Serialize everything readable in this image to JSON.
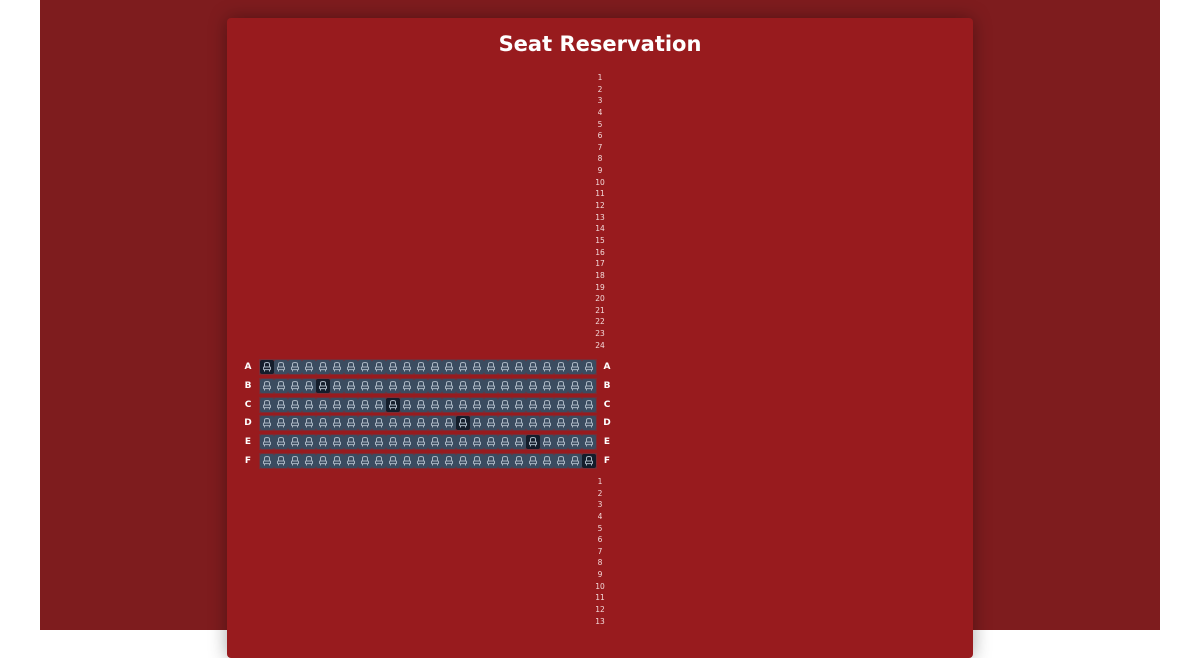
{
  "page": {
    "title": "Seat Reservation"
  },
  "column_numbers_top": [
    "1",
    "2",
    "3",
    "4",
    "5",
    "6",
    "7",
    "8",
    "9",
    "10",
    "11",
    "12",
    "13",
    "14",
    "15",
    "16",
    "17",
    "18",
    "19",
    "20",
    "21",
    "22",
    "23",
    "24"
  ],
  "column_numbers_bottom": [
    "1",
    "2",
    "3",
    "4",
    "5",
    "6",
    "7",
    "8",
    "9",
    "10",
    "11",
    "12",
    "13"
  ],
  "seat_icon": "seat-icon",
  "colors": {
    "background": "#7e1c1e",
    "card": "#981b1e",
    "seat": "#3b4c60",
    "seat_selected": "#141d2b",
    "seat_icon": "#a9b5c2"
  },
  "rows": [
    {
      "label": "A",
      "selected_seat": 1
    },
    {
      "label": "B",
      "selected_seat": 5
    },
    {
      "label": "C",
      "selected_seat": 10
    },
    {
      "label": "D",
      "selected_seat": 15
    },
    {
      "label": "E",
      "selected_seat": 20
    },
    {
      "label": "F",
      "selected_seat": 24
    }
  ],
  "seats_per_row": 24
}
